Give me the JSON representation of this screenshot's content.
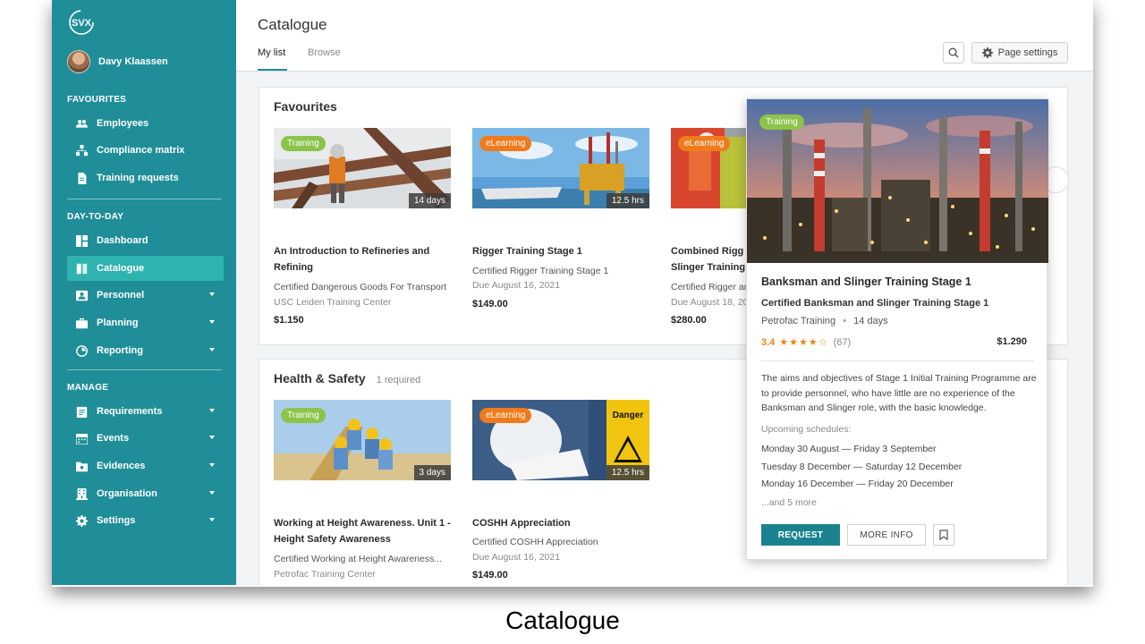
{
  "sidebar": {
    "logo_text": "SVX",
    "user_name": "Davy Klaassen",
    "sections": [
      {
        "title": "FAVOURITES"
      },
      {
        "title": "DAY-TO-DAY"
      },
      {
        "title": "MANAGE"
      }
    ],
    "items": [
      {
        "label": "Employees",
        "icon": "users-icon"
      },
      {
        "label": "Compliance matrix",
        "icon": "hierarchy-icon"
      },
      {
        "label": "Training requests",
        "icon": "document-icon"
      },
      {
        "label": "Dashboard",
        "icon": "dashboard-icon"
      },
      {
        "label": "Catalogue",
        "icon": "book-icon"
      },
      {
        "label": "Personnel",
        "icon": "person-card-icon"
      },
      {
        "label": "Planning",
        "icon": "briefcase-icon"
      },
      {
        "label": "Reporting",
        "icon": "chart-icon"
      },
      {
        "label": "Requirements",
        "icon": "clipboard-icon"
      },
      {
        "label": "Events",
        "icon": "calendar-icon"
      },
      {
        "label": "Evidences",
        "icon": "folder-icon"
      },
      {
        "label": "Organisation",
        "icon": "building-icon"
      },
      {
        "label": "Settings",
        "icon": "gear-icon"
      }
    ]
  },
  "header": {
    "title": "Catalogue",
    "tabs": [
      {
        "label": "My list"
      },
      {
        "label": "Browse"
      }
    ],
    "page_settings_label": "Page settings"
  },
  "favourites": {
    "title": "Favourites",
    "cards": [
      {
        "tag": "Training",
        "duration": "14 days",
        "title": "An Introduction to Refineries and Refining",
        "line1": "Certified Dangerous Goods For Transport",
        "line2": "USC Leiden Training Center",
        "price": "$1.150"
      },
      {
        "tag": "eLearning",
        "duration": "12.5 hrs",
        "title": "Rigger Training Stage 1",
        "line1": "Certified Rigger Training Stage 1",
        "line2": "Due August 16, 2021",
        "price": "$149.00"
      },
      {
        "tag": "eLearning",
        "duration": "",
        "title": "Combined Rigg Slinger Training",
        "line1": "Certified Rigger ar",
        "line2": "Due August 18, 20",
        "price": "$280.00"
      }
    ]
  },
  "health_safety": {
    "title": "Health & Safety",
    "subtitle": "1 required",
    "cards": [
      {
        "tag": "Training",
        "duration": "3 days",
        "title": "Working at Height Awareness. Unit 1 - Height Safety Awareness",
        "line1": "Certified Working at Height  Awareness...",
        "line2": "Petrofac Training Center",
        "price": ""
      },
      {
        "tag": "eLearning",
        "duration": "12.5 hrs",
        "title": "COSHH Appreciation",
        "line1": "Certified COSHH Appreciation",
        "line2": "Due August 16, 2021",
        "price": "$149.00"
      }
    ]
  },
  "popup": {
    "tag": "Training",
    "title": "Banksman and Slinger Training Stage 1",
    "subtitle": "Certified Banksman and Slinger Training Stage 1",
    "provider": "Petrofac Training",
    "duration": "14 days",
    "rating": "3.4",
    "stars": "★★★★☆",
    "reviews": "(67)",
    "price": "$1.290",
    "description": "The aims and objectives of Stage 1 Initial Training Programme are to provide personnel, who have little are no experience of the Banksman and Slinger role, with the basic knowledge.",
    "upcoming_label": "Upcoming schedules:",
    "schedules": [
      "Monday 30 August — Friday 3 September",
      "Tuesday 8 December — Saturday 12 December",
      "Monday 16 December — Friday 20 December"
    ],
    "more": "...and 5 more",
    "request_label": "REQUEST",
    "more_info_label": "MORE INFO"
  },
  "caption": "Catalogue",
  "colors": {
    "sidebar": "#1f8e98",
    "active": "#2fb3b0",
    "training_tag": "#8cc34b",
    "elearning_tag": "#f07b1d",
    "rating": "#e28a14",
    "request_button": "#1b8390"
  }
}
